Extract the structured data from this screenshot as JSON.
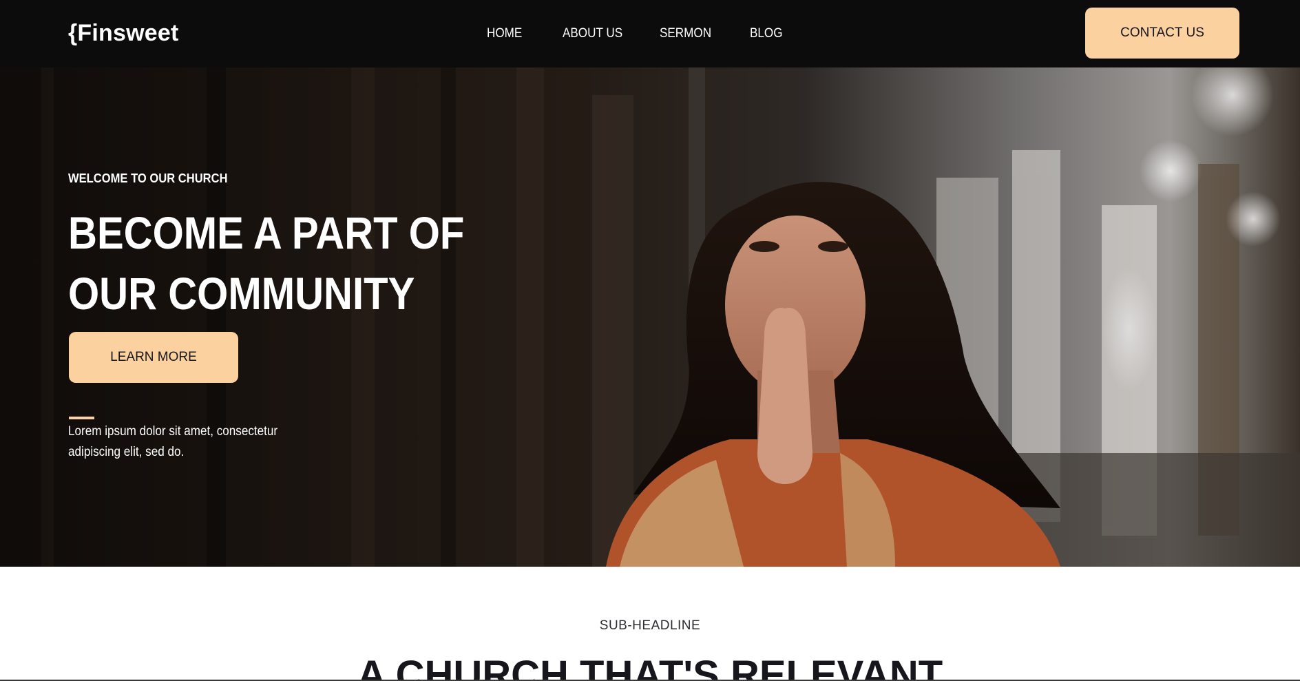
{
  "brand": {
    "logo_text": "{Finsweet"
  },
  "nav": {
    "links": [
      {
        "label": "HOME"
      },
      {
        "label": "ABOUT US"
      },
      {
        "label": "SERMON"
      },
      {
        "label": "BLOG"
      }
    ],
    "cta_label": "CONTACT US"
  },
  "hero": {
    "eyebrow": "WELCOME TO OUR CHURCH",
    "title_line1": "BECOME A PART OF",
    "title_line2": "OUR COMMUNITY",
    "button_label": "LEARN MORE",
    "description": "Lorem ipsum dolor sit amet, consectetur adipiscing elit, sed do."
  },
  "section": {
    "sub_headline": "SUB-HEADLINE",
    "title": "A CHURCH THAT'S RELEVANT"
  },
  "colors": {
    "nav_background": "#0c0c0c",
    "accent": "#fcd1a0",
    "text_dark": "#16161c",
    "text_light": "#ffffff"
  }
}
